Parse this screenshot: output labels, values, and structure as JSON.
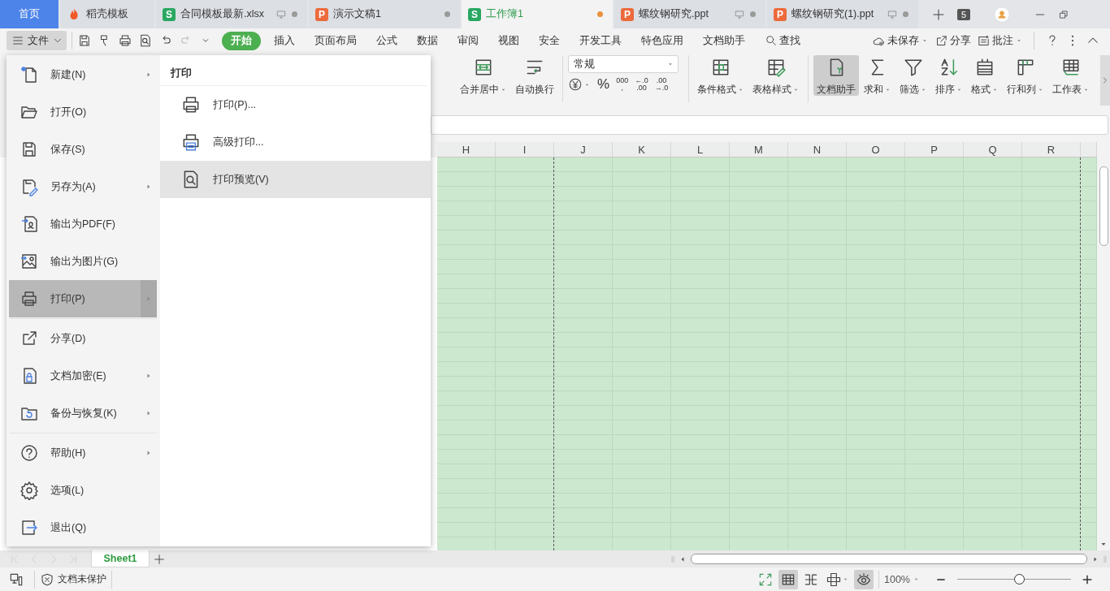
{
  "tabs": [
    {
      "kind": "home",
      "label": "首页",
      "selected": false
    },
    {
      "kind": "docer",
      "label": "稻壳模板",
      "selected": false
    },
    {
      "kind": "sheet",
      "icon_letter": "S",
      "label": "合同模板最新.xlsx",
      "selected": false,
      "local_file": true,
      "modified": false
    },
    {
      "kind": "slides",
      "icon_letter": "P",
      "label": "演示文稿1",
      "selected": false,
      "local_file": false,
      "modified": false
    },
    {
      "kind": "sheet",
      "icon_letter": "S",
      "label": "工作簿1",
      "selected": true,
      "local_file": false,
      "modified": true
    },
    {
      "kind": "slides",
      "icon_letter": "P",
      "label": "螺纹钢研究.ppt",
      "selected": false,
      "local_file": true,
      "modified": false
    },
    {
      "kind": "slides",
      "icon_letter": "P",
      "label": "螺纹钢研究(1).ppt",
      "selected": false,
      "local_file": true,
      "modified": false
    }
  ],
  "tab_count": "5",
  "file_button": {
    "label": "文件"
  },
  "menu_tabs": [
    {
      "label": "开始",
      "selected": true
    },
    {
      "label": "插入",
      "selected": false
    },
    {
      "label": "页面布局",
      "selected": false
    },
    {
      "label": "公式",
      "selected": false
    },
    {
      "label": "数据",
      "selected": false
    },
    {
      "label": "审阅",
      "selected": false
    },
    {
      "label": "视图",
      "selected": false
    },
    {
      "label": "安全",
      "selected": false
    },
    {
      "label": "开发工具",
      "selected": false
    },
    {
      "label": "特色应用",
      "selected": false
    },
    {
      "label": "文档助手",
      "selected": false
    }
  ],
  "search": {
    "label": "查找"
  },
  "header_actions": [
    {
      "kind": "cloud",
      "label": "未保存",
      "dropdown": true
    },
    {
      "kind": "share",
      "label": "分享",
      "dropdown": false
    },
    {
      "kind": "comment",
      "label": "批注",
      "dropdown": true
    }
  ],
  "ribbon": {
    "left_tools": [
      {
        "kind": "merge",
        "label": "合并居中",
        "dropdown": true,
        "active": false
      },
      {
        "kind": "wrap",
        "label": "自动换行",
        "dropdown": false,
        "active": false
      }
    ],
    "number_format": {
      "value": "常规"
    },
    "number_buttons": [
      {
        "kind": "currency",
        "dropdown": true
      },
      {
        "kind": "text",
        "lines": [
          "%"
        ]
      },
      {
        "kind": "text",
        "lines": [
          "000",
          ","
        ]
      },
      {
        "kind": "text",
        "lines": [
          "←.0",
          ".00"
        ]
      },
      {
        "kind": "text",
        "lines": [
          ".00",
          "→.0"
        ]
      }
    ],
    "style_tools": [
      {
        "kind": "cond",
        "label": "条件格式",
        "dropdown": true,
        "active": false
      },
      {
        "kind": "tstyle",
        "label": "表格样式",
        "dropdown": true,
        "active": false
      }
    ],
    "tools": [
      {
        "kind": "helper",
        "label": "文档助手",
        "dropdown": false,
        "active": true
      },
      {
        "kind": "sum",
        "label": "求和",
        "dropdown": true,
        "active": false
      },
      {
        "kind": "filter",
        "label": "筛选",
        "dropdown": true,
        "active": false
      },
      {
        "kind": "sort",
        "label": "排序",
        "dropdown": true,
        "active": false
      },
      {
        "kind": "format",
        "label": "格式",
        "dropdown": true,
        "active": false
      },
      {
        "kind": "rowcol",
        "label": "行和列",
        "dropdown": true,
        "active": false
      },
      {
        "kind": "worksheet",
        "label": "工作表",
        "dropdown": true,
        "active": false
      }
    ]
  },
  "columns": [
    {
      "label": "H",
      "page_break": false
    },
    {
      "label": "I",
      "page_break": true
    },
    {
      "label": "J",
      "page_break": false
    },
    {
      "label": "K",
      "page_break": false
    },
    {
      "label": "L",
      "page_break": false
    },
    {
      "label": "M",
      "page_break": false
    },
    {
      "label": "N",
      "page_break": false
    },
    {
      "label": "O",
      "page_break": false
    },
    {
      "label": "P",
      "page_break": false
    },
    {
      "label": "Q",
      "page_break": false
    },
    {
      "label": "R",
      "page_break": true
    }
  ],
  "file_menu": {
    "groups": [
      [
        {
          "kind": "new",
          "label": "新建(N)",
          "submenu": true,
          "selected": false
        },
        {
          "kind": "open",
          "label": "打开(O)",
          "submenu": false,
          "selected": false
        },
        {
          "kind": "save",
          "label": "保存(S)",
          "submenu": false,
          "selected": false
        },
        {
          "kind": "saveas",
          "label": "另存为(A)",
          "submenu": true,
          "selected": false
        },
        {
          "kind": "pdf",
          "label": "输出为PDF(F)",
          "submenu": false,
          "selected": false
        },
        {
          "kind": "image",
          "label": "输出为图片(G)",
          "submenu": false,
          "selected": false
        },
        {
          "kind": "print",
          "label": "打印(P)",
          "submenu": true,
          "selected": true
        }
      ],
      [
        {
          "kind": "share",
          "label": "分享(D)",
          "submenu": false,
          "selected": false
        },
        {
          "kind": "encrypt",
          "label": "文档加密(E)",
          "submenu": true,
          "selected": false
        },
        {
          "kind": "backup",
          "label": "备份与恢复(K)",
          "submenu": true,
          "selected": false
        }
      ],
      [
        {
          "kind": "help",
          "label": "帮助(H)",
          "submenu": true,
          "selected": false
        },
        {
          "kind": "options",
          "label": "选项(L)",
          "submenu": false,
          "selected": false
        },
        {
          "kind": "exit",
          "label": "退出(Q)",
          "submenu": false,
          "selected": false
        }
      ]
    ]
  },
  "print_submenu": {
    "title": "打印",
    "items": [
      {
        "kind": "print",
        "label": "打印(P)...",
        "selected": false
      },
      {
        "kind": "advanced",
        "label": "高级打印...",
        "selected": false
      },
      {
        "kind": "preview",
        "label": "打印预览(V)",
        "selected": true
      }
    ]
  },
  "sheets": [
    {
      "label": "Sheet1",
      "selected": true
    }
  ],
  "status_bar": {
    "protection": "文档未保护",
    "view_modes": [
      {
        "kind": "fullscreen",
        "selected": false
      },
      {
        "kind": "normal",
        "selected": true
      },
      {
        "kind": "pagebreak",
        "selected": false
      },
      {
        "kind": "reading",
        "selected": false
      },
      {
        "kind": "eye",
        "selected": true
      }
    ],
    "zoom": "100%",
    "zoom_slider": {
      "level": 0.55
    }
  }
}
